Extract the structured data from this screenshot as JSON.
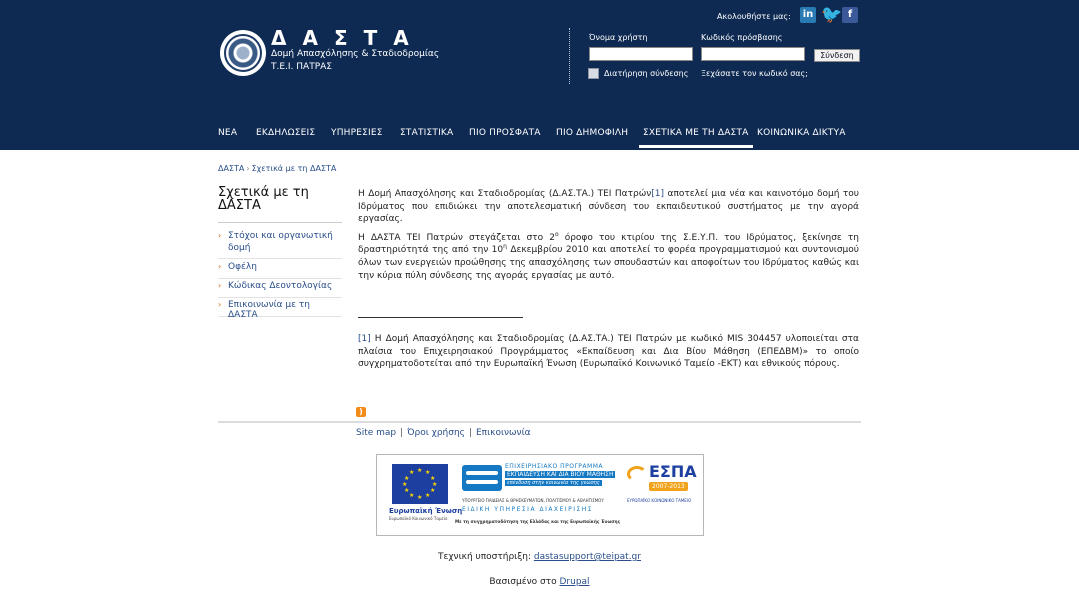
{
  "header": {
    "site_name": "ΔΑΣΤΑ",
    "slogan_line1": "Δομή Απασχόλησης & Σταδιοδρομίας",
    "slogan_line2": "Τ.Ε.Ι. ΠΑΤΡΑΣ",
    "follow_label": "Ακολουθήστε μας:",
    "social_icons": [
      "linkedin-icon",
      "twitter-icon",
      "facebook-icon"
    ],
    "background_color": "#0e2a52"
  },
  "login": {
    "username_label": "Όνομα χρήστη",
    "password_label": "Κωδικός πρόσβασης",
    "username_value": "",
    "password_value": "",
    "submit_label": "Σύνδεση",
    "remember_label": "Διατήρηση σύνδεσης",
    "forgot_label": "Ξεχάσατε τον κωδικό σας;"
  },
  "nav": {
    "items": [
      {
        "label": "ΝΕΑ"
      },
      {
        "label": "ΕΚΔΗΛΩΣΕΙΣ"
      },
      {
        "label": "ΥΠΗΡΕΣΙΕΣ"
      },
      {
        "label": "ΣΤΑΤΙΣΤΙΚΑ"
      },
      {
        "label": "ΠΙΟ ΠΡΟΣΦΑΤΑ"
      },
      {
        "label": "ΠΙΟ ΔΗΜΟΦΙΛΗ"
      },
      {
        "label": "ΣΧΕΤΙΚΑ ΜΕ ΤΗ ΔΑΣΤΑ"
      },
      {
        "label": "ΚΟΙΝΩΝΙΚΑ ΔΙΚΤΥΑ"
      }
    ],
    "active": "ΣΧΕΤΙΚΑ ΜΕ ΤΗ ΔΑΣΤΑ"
  },
  "breadcrumb": {
    "home": "ΔΑΣΤΑ",
    "separator": "›",
    "current": "Σχετικά με τη ΔΑΣΤΑ"
  },
  "sidebar": {
    "title": "Σχετικά με τη ΔΑΣΤΑ",
    "items": [
      {
        "label": "Στόχοι και οργανωτική δομή"
      },
      {
        "label": "Οφέλη"
      },
      {
        "label": "Κώδικας Δεοντολογίας"
      },
      {
        "label": "Επικοινωνία με τη ΔΑΣΤΑ"
      }
    ]
  },
  "content": {
    "p1_before": "Η Δομή Απασχόλησης και Σταδιοδρομίας (Δ.ΑΣ.ΤΑ.) ΤΕΙ Πατρών",
    "p1_ref": "[1]",
    "p1_after": " αποτελεί μια νέα και καινοτόμο δομή του Ιδρύματος που επιδιώκει την αποτελεσματική σύνδεση του εκπαιδευτικού συστήματος με την αγορά εργασίας.",
    "p2_a": "Η ΔΑΣΤΑ ΤΕΙ Πατρών στεγάζεται στο 2",
    "p2_sup1": "ο",
    "p2_b": " όροφο του κτιρίου της Σ.Ε.Υ.Π. του Ιδρύματος, ξεκίνησε τη δραστηριότητά της από την 10",
    "p2_sup2": "η",
    "p2_c": " Δεκεμβρίου 2010 και αποτελεί το φορέα προγραμματισμού και συντονισμού όλων των ενεργειών προώθησης της απασχόλησης των σπουδαστών και αποφοίτων του Ιδρύματος καθώς και την κύρια πύλη σύνδεσης της αγοράς εργασίας με αυτό.",
    "footnote_ref": "[1]",
    "footnote_text": " Η Δομή Απασχόλησης και Σταδιοδρομίας (Δ.ΑΣ.ΤΑ.) ΤΕΙ Πατρών με κωδικό MIS 304457 υλοποιείται στα πλαίσια του Επιχειρησιακού Προγράμματος «Εκπαίδευση και Δια Βίου Μάθηση (ΕΠΕΔΒΜ)» το οποίο συγχρηματοδοτείται από την Ευρωπαϊκή Ένωση (Ευρωπαϊκό Κοινωνικό Ταμείο -ΕΚΤ) και εθνικούς πόρους."
  },
  "footer": {
    "links": [
      {
        "label": "Site map"
      },
      {
        "label": "Όροι χρήσης"
      },
      {
        "label": "Επικοινωνία"
      }
    ],
    "link_separator": "|",
    "banner": {
      "eu_title": "Ευρωπαϊκή Ένωση",
      "eu_sub": "Ευρωπαϊκό Κοινωνικό Ταμείο",
      "op_title1": "ΕΠΙΧΕΙΡΗΣΙΑΚΟ ΠΡΟΓΡΑΜΜΑ",
      "op_title2": "ΕΚΠΑΙΔΕΥΣΗ ΚΑΙ ΔΙΑ ΒΙΟΥ ΜΑΘΗΣΗ",
      "op_title3": "επένδυση στην κοινωνία της γνώσης",
      "ministry": "ΥΠΟΥΡΓΕΙΟ ΠΑΙΔΕΙΑΣ & ΘΡΗΣΚΕΥΜΑΤΩΝ, ΠΟΛΙΤΙΣΜΟΥ & ΑΘΛΗΤΙΣΜΟΥ",
      "authority": "ΕΙΔΙΚΗ ΥΠΗΡΕΣΙΑ ΔΙΑΧΕΙΡΙΣΗΣ",
      "cofund": "Με τη συγχρηματοδότηση της Ελλάδας και της Ευρωπαϊκής Ένωσης",
      "espa_title": "ΕΣΠΑ",
      "espa_years": "2007-2013",
      "espa_sub": "ΕΥΡΩΠΑΪΚΟ ΚΟΙΝΩΝΙΚΟ ΤΑΜΕΙΟ"
    },
    "support_label": "Τεχνική υποστήριξη:",
    "support_email": "dastasupport@teipat.gr",
    "powered_label": "Βασισμένο στο",
    "powered_link": "Drupal"
  }
}
